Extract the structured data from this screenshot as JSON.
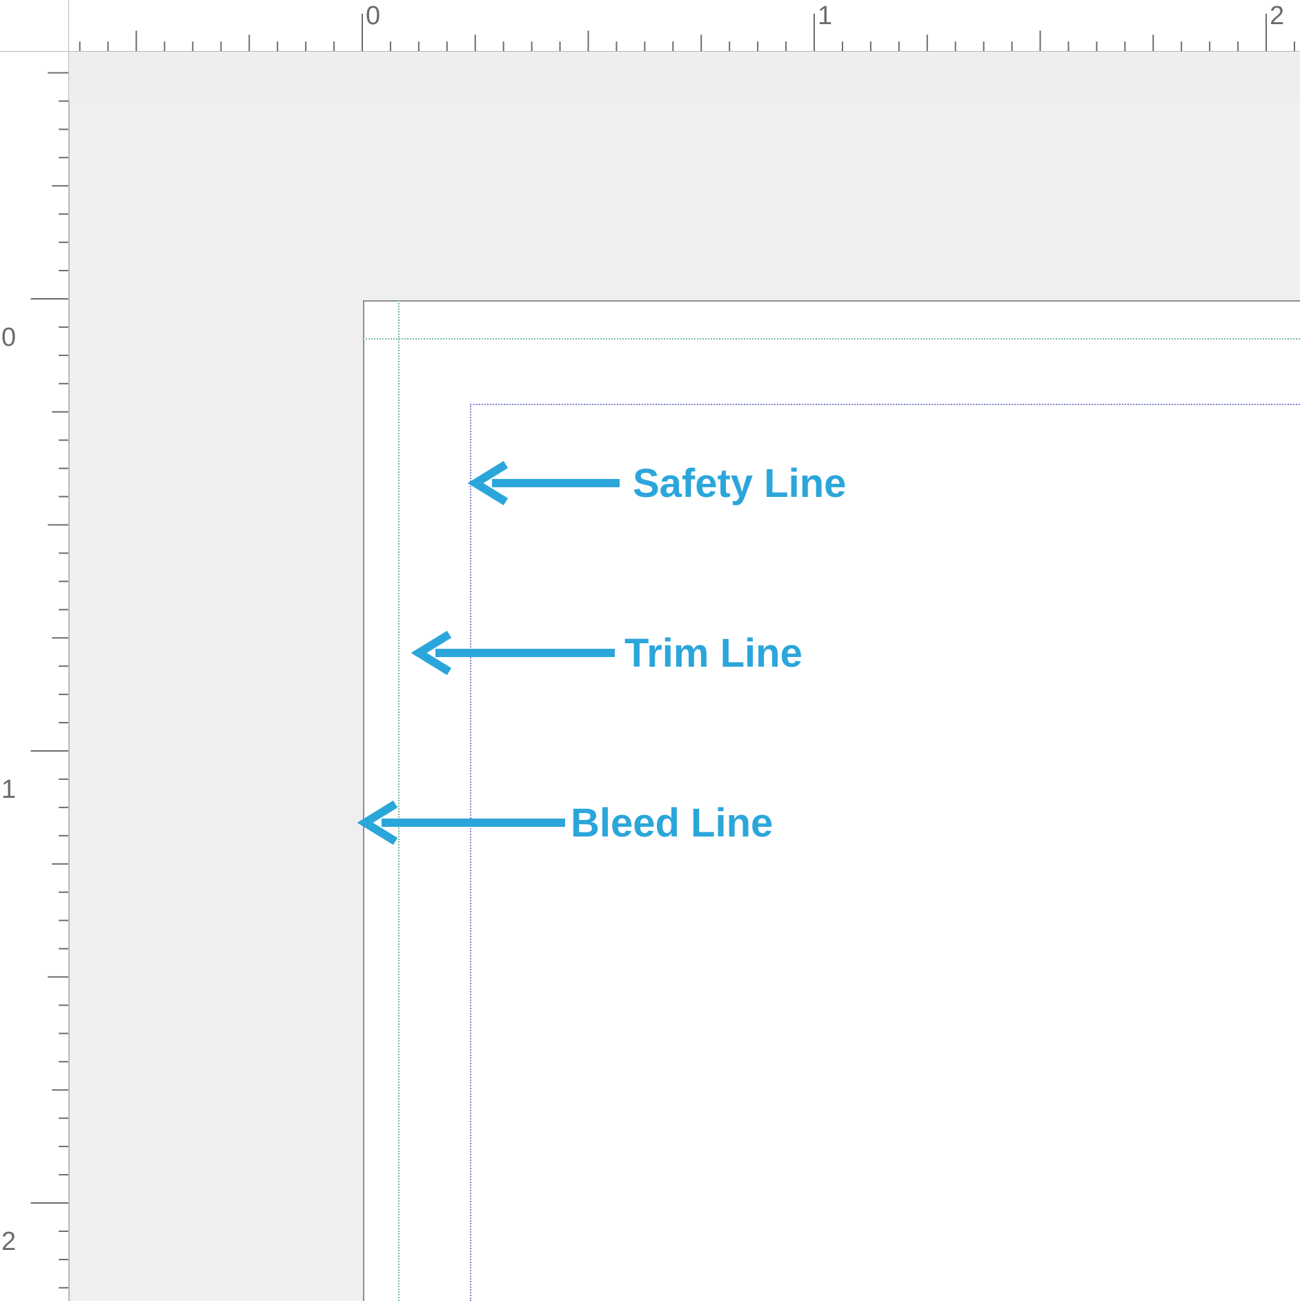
{
  "ruler": {
    "h": {
      "marks": [
        "0",
        "1",
        "2"
      ]
    },
    "v": {
      "marks": [
        "0",
        "1",
        "2"
      ]
    }
  },
  "annotations": {
    "safety": "Safety Line",
    "trim": "Trim Line",
    "bleed": "Bleed Line"
  },
  "colors": {
    "accent": "#2ba6da",
    "trim_guide": "#74b993",
    "safety_guide": "#7780cc",
    "canvas_bg": "#efefef",
    "page_bg": "#ffffff"
  }
}
